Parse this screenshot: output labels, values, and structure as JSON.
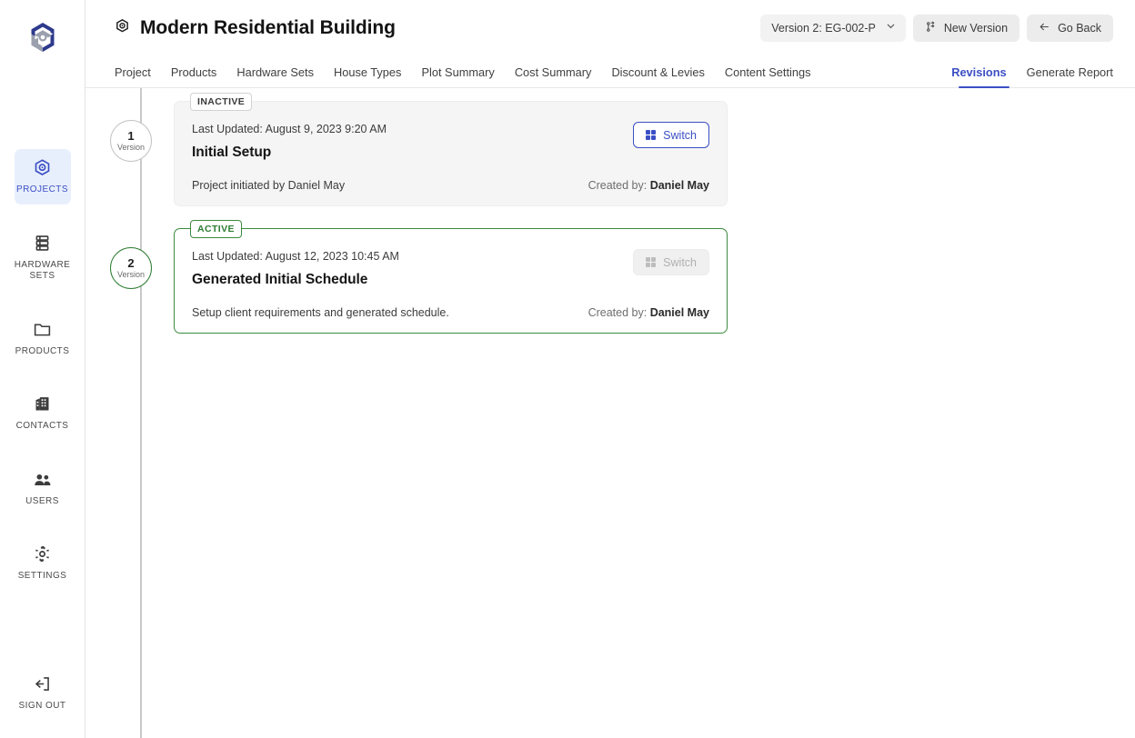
{
  "sidebar": {
    "logo_name": "company-hexagon-logo",
    "items": [
      {
        "label": "PROJECTS",
        "icon": "hexagon-target-icon",
        "active": true
      },
      {
        "label": "HARDWARE\nSETS",
        "icon": "hardware-stack-icon",
        "active": false
      },
      {
        "label": "PRODUCTS",
        "icon": "folder-icon",
        "active": false
      },
      {
        "label": "CONTACTS",
        "icon": "building-icon",
        "active": false
      },
      {
        "label": "USERS",
        "icon": "users-group-icon",
        "active": false
      },
      {
        "label": "SETTINGS",
        "icon": "gear-icon",
        "active": false
      }
    ],
    "signout": {
      "label": "SIGN OUT",
      "icon": "sign-out-icon"
    }
  },
  "header": {
    "title": "Modern Residential Building",
    "title_icon": "hexagon-target-icon",
    "version_select": {
      "value": "Version 2: EG-002-P",
      "chevron_icon": "chevron-down-icon"
    },
    "new_version_button": {
      "label": "New Version",
      "icon": "git-branch-icon"
    },
    "go_back_button": {
      "label": "Go Back",
      "icon": "arrow-left-icon"
    }
  },
  "tabs": {
    "left": [
      {
        "label": "Project",
        "active": false
      },
      {
        "label": "Products",
        "active": false
      },
      {
        "label": "Hardware Sets",
        "active": false
      },
      {
        "label": "House Types",
        "active": false
      },
      {
        "label": "Plot Summary",
        "active": false
      },
      {
        "label": "Cost Summary",
        "active": false
      },
      {
        "label": "Discount & Levies",
        "active": false
      },
      {
        "label": "Content Settings",
        "active": false
      }
    ],
    "right": [
      {
        "label": "Revisions",
        "active": true
      },
      {
        "label": "Generate Report",
        "active": false
      }
    ]
  },
  "revisions": [
    {
      "marker_number": "1",
      "marker_label": "Version",
      "status_badge": "INACTIVE",
      "status": "inactive",
      "last_updated": "Last Updated: August 9, 2023 9:20 AM",
      "title": "Initial Setup",
      "description": "Project initiated by Daniel May",
      "created_by_label": "Created by:",
      "created_by_name": "Daniel May",
      "switch_label": "Switch",
      "switch_enabled": true
    },
    {
      "marker_number": "2",
      "marker_label": "Version",
      "status_badge": "ACTIVE",
      "status": "active",
      "last_updated": "Last Updated: August 12, 2023 10:45 AM",
      "title": "Generated Initial Schedule",
      "description": "Setup client requirements and generated schedule.",
      "created_by_label": "Created by:",
      "created_by_name": "Daniel May",
      "switch_label": "Switch",
      "switch_enabled": false
    }
  ],
  "colors": {
    "accent_blue": "#3b4fc4",
    "active_green": "#3d8b40",
    "sidebar_active_bg": "#e8effc",
    "card_inactive_bg": "#f5f5f5",
    "border_gray": "#e3e3e3"
  }
}
